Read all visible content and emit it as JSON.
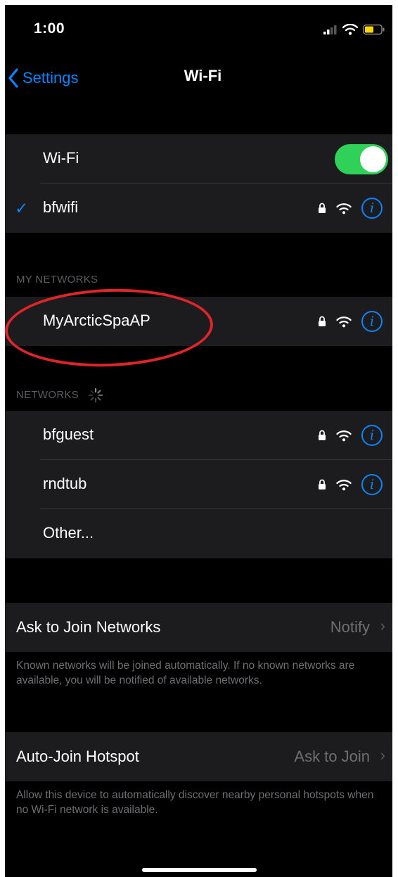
{
  "status_bar": {
    "time": "1:00"
  },
  "nav": {
    "back_label": "Settings",
    "title": "Wi-Fi"
  },
  "wifi_toggle": {
    "label": "Wi-Fi",
    "on": true
  },
  "connected": {
    "name": "bfwifi"
  },
  "my_networks": {
    "header": "MY NETWORKS",
    "items": [
      {
        "name": "MyArcticSpaAP"
      }
    ]
  },
  "networks": {
    "header": "NETWORKS",
    "items": [
      {
        "name": "bfguest"
      },
      {
        "name": "rndtub"
      }
    ],
    "other_label": "Other..."
  },
  "ask_to_join": {
    "label": "Ask to Join Networks",
    "value": "Notify",
    "footnote": "Known networks will be joined automatically. If no known networks are available, you will be notified of available networks."
  },
  "auto_join": {
    "label": "Auto-Join Hotspot",
    "value": "Ask to Join",
    "footnote": "Allow this device to automatically discover nearby personal hotspots when no Wi-Fi network is available."
  },
  "colors": {
    "accent": "#0a84ff",
    "toggle_on": "#30d158",
    "annotation": "#e0242c",
    "background": "#000000",
    "cell": "#1c1c1e"
  },
  "icons": [
    "chevron-left-icon",
    "lock-icon",
    "wifi-icon",
    "info-icon",
    "checkmark-icon",
    "cellular-signal-icon",
    "battery-icon",
    "spinner-icon",
    "chevron-right-icon"
  ]
}
